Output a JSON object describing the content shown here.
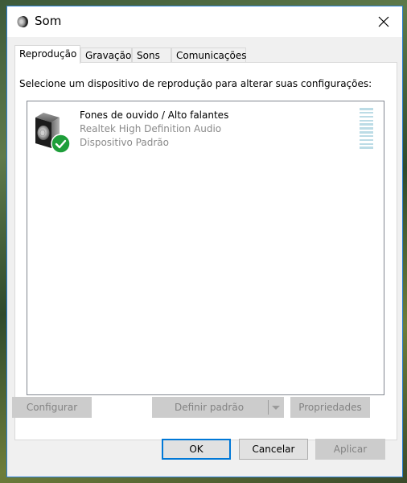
{
  "window": {
    "title": "Som",
    "icon": "speaker-icon",
    "close_icon": "close-icon"
  },
  "tabs": [
    {
      "label": "Reprodução",
      "active": true
    },
    {
      "label": "Gravação",
      "active": false
    },
    {
      "label": "Sons",
      "active": false
    },
    {
      "label": "Comunicações",
      "active": false
    }
  ],
  "playback": {
    "instruction": "Selecione um dispositivo de reprodução para alterar suas configurações:",
    "devices": [
      {
        "name": "Fones de ouvido / Alto falantes",
        "driver": "Realtek High Definition Audio",
        "status": "Dispositivo Padrão",
        "icon": "speaker-device-icon",
        "badge": "default-check-icon",
        "level": 0
      }
    ]
  },
  "panel_buttons": {
    "configure": "Configurar",
    "set_default": "Definir padrão",
    "properties": "Propriedades"
  },
  "dialog_buttons": {
    "ok": "OK",
    "cancel": "Cancelar",
    "apply": "Aplicar"
  },
  "colors": {
    "accent": "#0078d7",
    "window_border": "#2b7fd4",
    "check_badge": "#1e9e3a",
    "level_meter": "#bcdce6"
  }
}
